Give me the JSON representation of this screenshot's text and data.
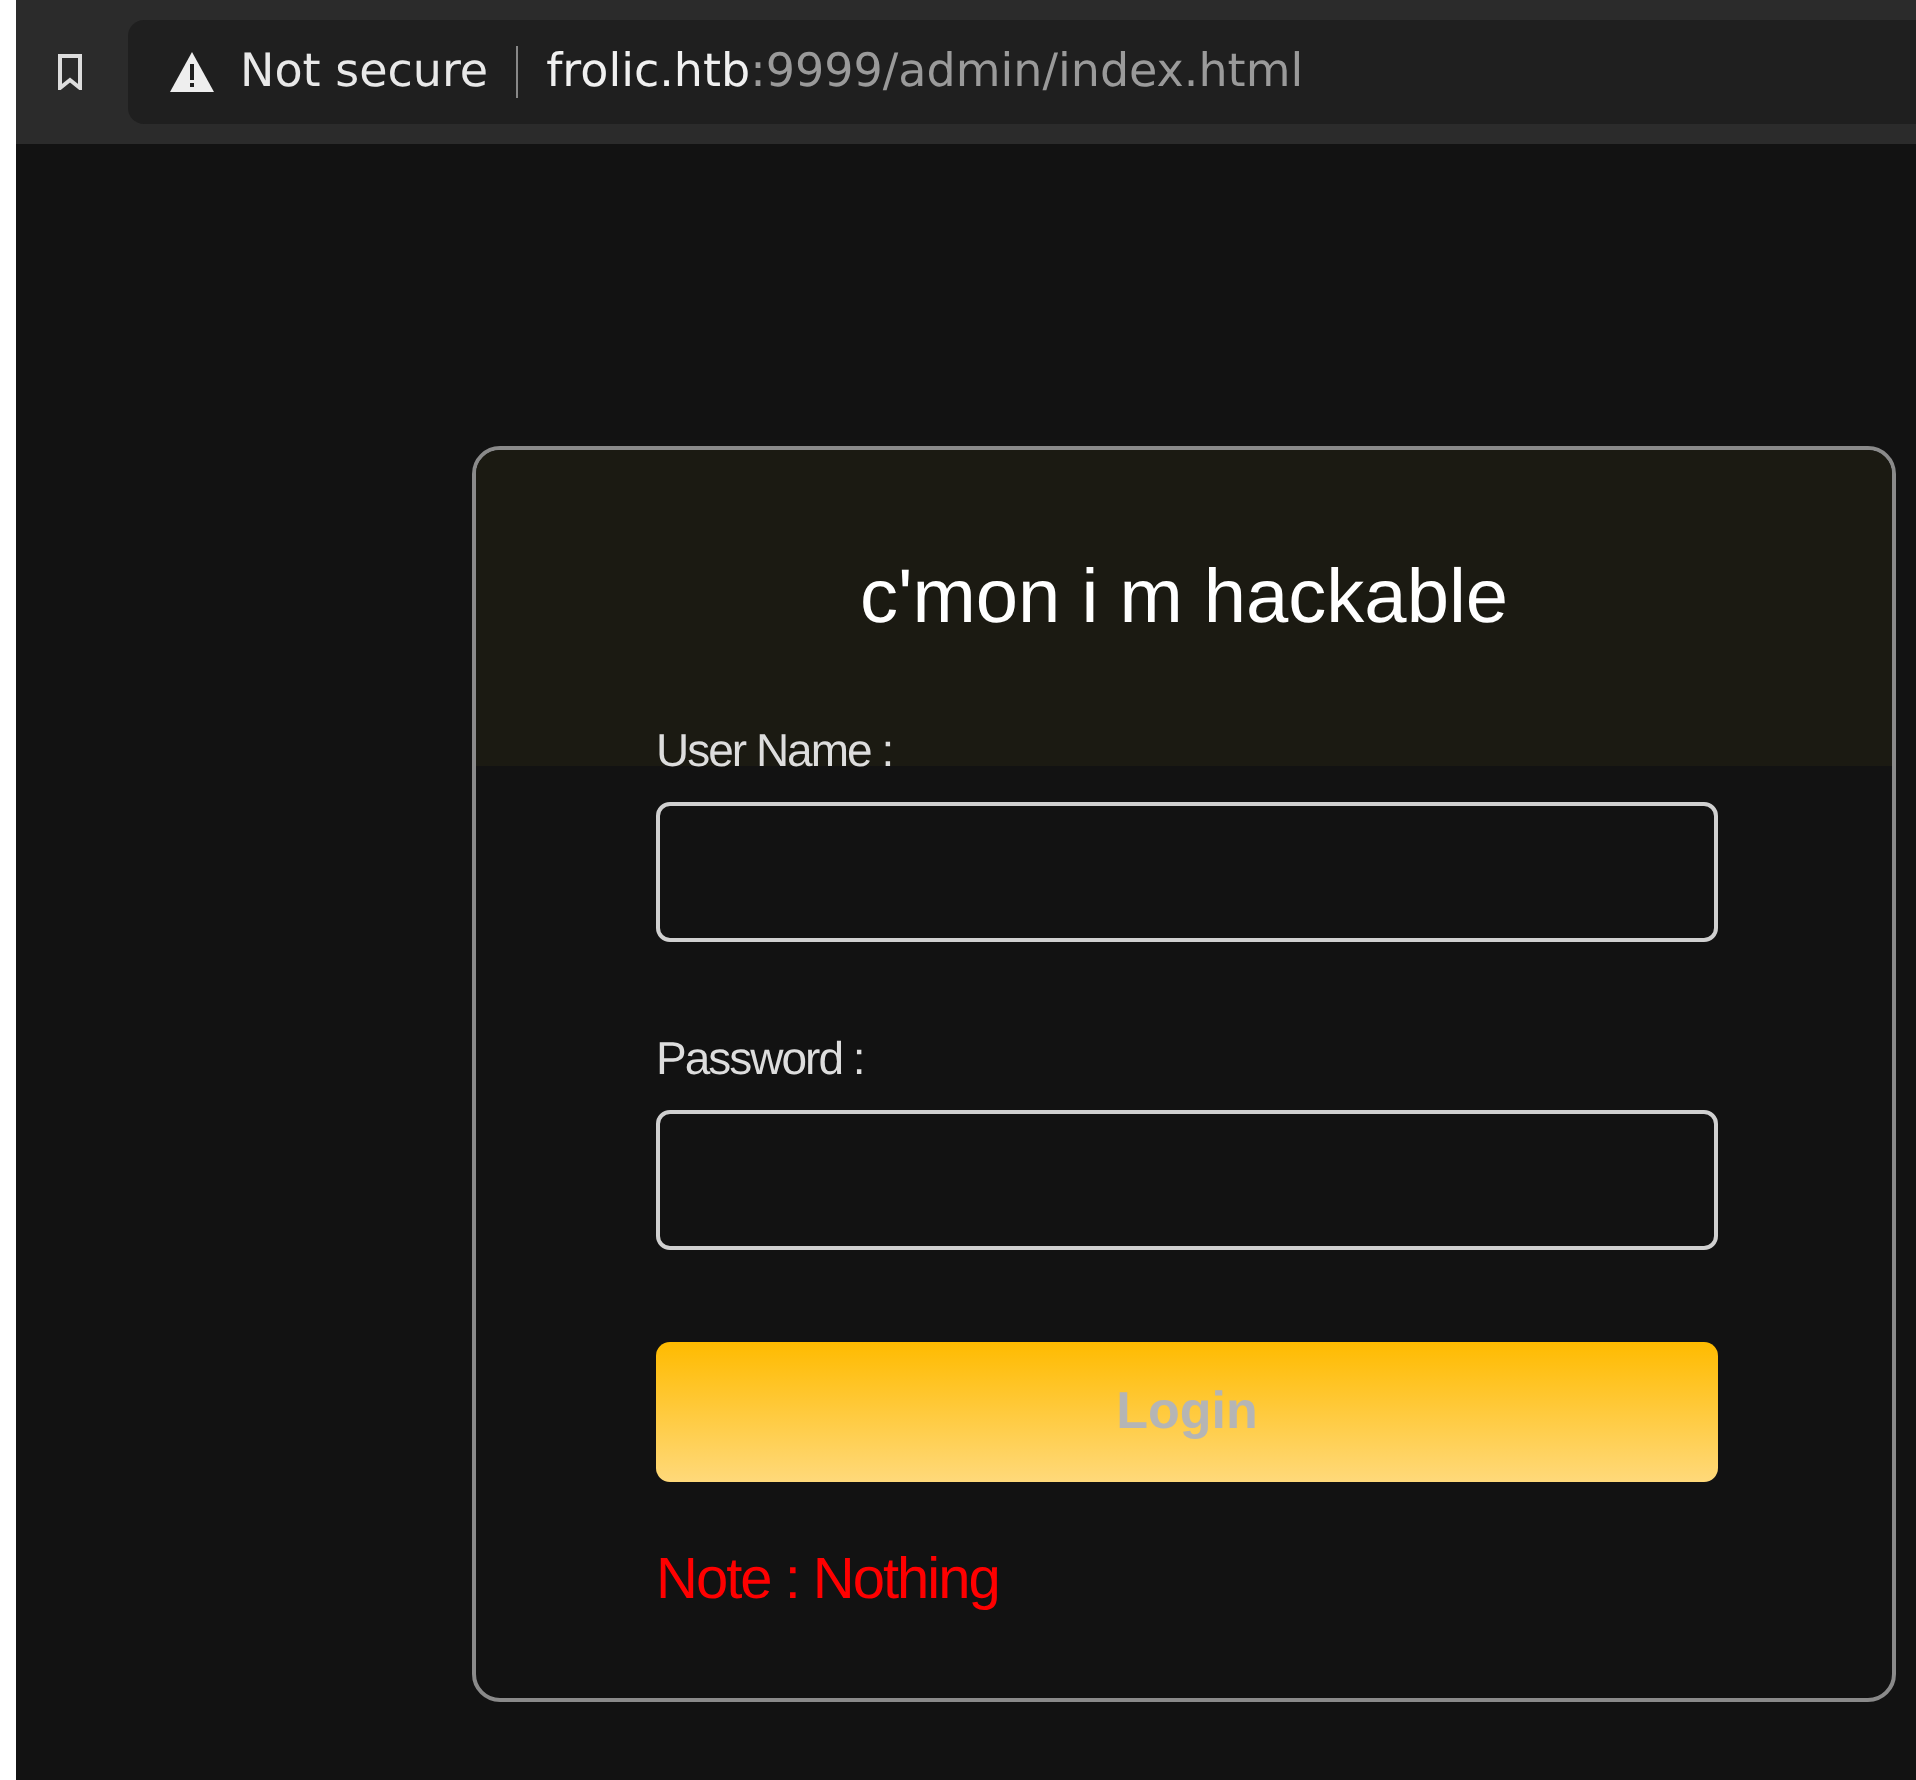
{
  "browser": {
    "security": "Not secure",
    "url_host": "frolic.htb",
    "url_rest": ":9999/admin/index.html"
  },
  "form": {
    "title": "c'mon i m hackable",
    "fields": [
      {
        "label": "User Name :"
      },
      {
        "label": "Password :"
      }
    ],
    "button": "Login",
    "note": "Note : Nothing"
  }
}
